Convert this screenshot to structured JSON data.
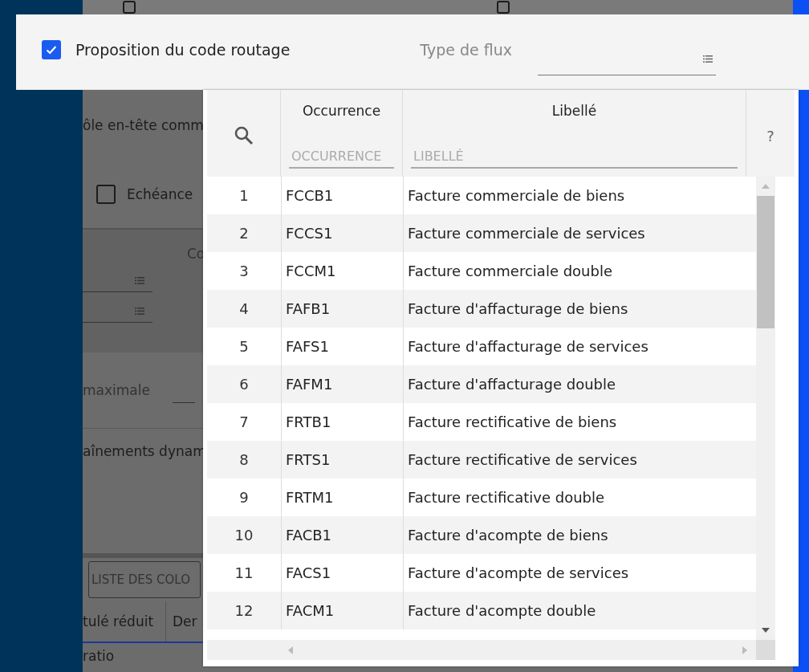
{
  "background_form": {
    "top_checkboxes": [
      {
        "checked": false
      },
      {
        "checked": false
      }
    ],
    "header_text": "ôle en-tête comm",
    "due_checkbox": {
      "label": "Echéance",
      "checked": false
    },
    "column_label": "Co",
    "max_label": "maximale",
    "chain_label": "aînements dynam",
    "columns_button": "LISTE DES COLO",
    "table_headers": [
      "tulé réduit",
      "Der"
    ],
    "table_cell": "ratio"
  },
  "top_panel": {
    "routing_checkbox": {
      "label": "Proposition du code routage",
      "checked": true
    },
    "flux_field": {
      "label": "Type de flux"
    }
  },
  "lookup": {
    "columns": [
      {
        "title": "Occurrence",
        "placeholder": "OCCURRENCE"
      },
      {
        "title": "Libellé",
        "placeholder": "LIBELLÉ"
      }
    ],
    "help": "?",
    "rows": [
      {
        "index": "1",
        "occurrence": "FCCB1",
        "label": "Facture commerciale de biens"
      },
      {
        "index": "2",
        "occurrence": "FCCS1",
        "label": "Facture commerciale de services"
      },
      {
        "index": "3",
        "occurrence": "FCCM1",
        "label": "Facture commerciale double"
      },
      {
        "index": "4",
        "occurrence": "FAFB1",
        "label": "Facture d'affacturage de biens"
      },
      {
        "index": "5",
        "occurrence": "FAFS1",
        "label": "Facture d'affacturage de services"
      },
      {
        "index": "6",
        "occurrence": "FAFM1",
        "label": "Facture d'affacturage double"
      },
      {
        "index": "7",
        "occurrence": "FRTB1",
        "label": "Facture rectificative de biens"
      },
      {
        "index": "8",
        "occurrence": "FRTS1",
        "label": "Facture rectificative de services"
      },
      {
        "index": "9",
        "occurrence": "FRTM1",
        "label": "Facture rectificative double"
      },
      {
        "index": "10",
        "occurrence": "FACB1",
        "label": "Facture d'acompte de biens"
      },
      {
        "index": "11",
        "occurrence": "FACS1",
        "label": "Facture d'acompte de services"
      },
      {
        "index": "12",
        "occurrence": "FACM1",
        "label": "Facture d'acompte double"
      }
    ]
  }
}
